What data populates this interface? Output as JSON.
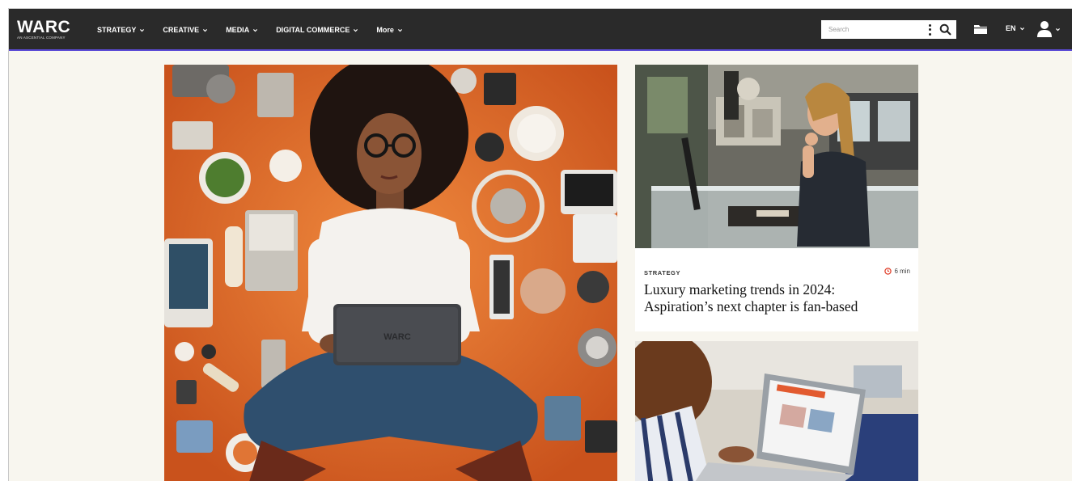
{
  "brand": {
    "name": "WARC",
    "tagline": "AN ASCENTIAL COMPANY"
  },
  "nav": {
    "items": [
      {
        "label": "STRATEGY"
      },
      {
        "label": "CREATIVE"
      },
      {
        "label": "MEDIA"
      },
      {
        "label": "DIGITAL COMMERCE"
      },
      {
        "label": "More"
      }
    ],
    "search_placeholder": "Search",
    "language": "EN"
  },
  "cards": [
    {
      "category": "STRATEGY",
      "read_time": "6 min",
      "headline_line1": "Luxury marketing trends in 2024:",
      "headline_line2": "Aspiration’s next chapter is fan-based"
    }
  ],
  "colors": {
    "nav_bg": "#2a2a2a",
    "nav_underline": "#5b4bd6",
    "page_bg": "#f8f6ef",
    "readtime_icon": "#e0402b",
    "hero_bg": "#e06a2c"
  }
}
